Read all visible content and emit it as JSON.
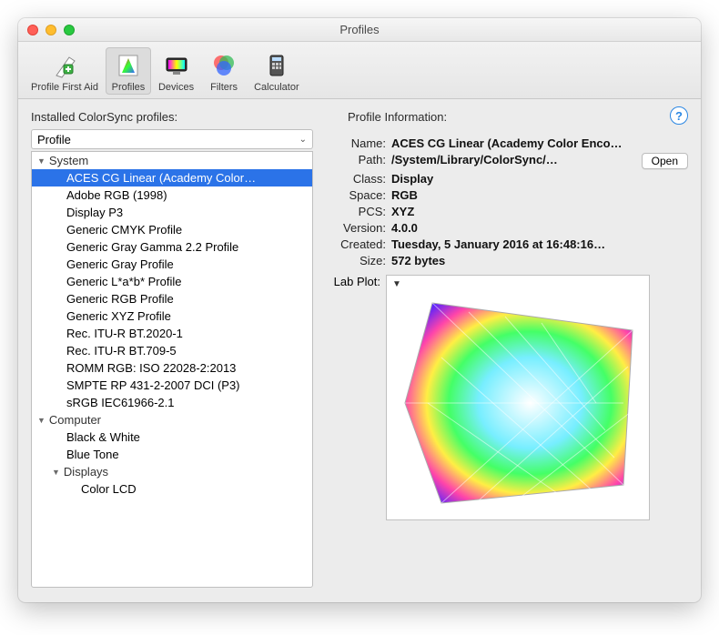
{
  "title": "Profiles",
  "toolbar": [
    {
      "label": "Profile First Aid",
      "name": "tb-profile-first-aid"
    },
    {
      "label": "Profiles",
      "name": "tb-profiles"
    },
    {
      "label": "Devices",
      "name": "tb-devices"
    },
    {
      "label": "Filters",
      "name": "tb-filters"
    },
    {
      "label": "Calculator",
      "name": "tb-calculator"
    }
  ],
  "left_heading": "Installed ColorSync profiles:",
  "dropdown_value": "Profile",
  "groups": {
    "system_label": "System",
    "computer_label": "Computer",
    "displays_label": "Displays"
  },
  "system_items": [
    "ACES CG Linear (Academy Color…",
    "Adobe RGB (1998)",
    "Display P3",
    "Generic CMYK Profile",
    "Generic Gray Gamma 2.2 Profile",
    "Generic Gray Profile",
    "Generic L*a*b* Profile",
    "Generic RGB Profile",
    "Generic XYZ Profile",
    "Rec. ITU-R BT.2020-1",
    "Rec. ITU-R BT.709-5",
    "ROMM RGB: ISO 22028-2:2013",
    "SMPTE RP 431-2-2007 DCI (P3)",
    "sRGB IEC61966-2.1"
  ],
  "computer_items": [
    "Black & White",
    "Blue Tone"
  ],
  "displays_items": [
    "Color LCD"
  ],
  "right_heading": "Profile Information:",
  "info_labels": {
    "name": "Name:",
    "path": "Path:",
    "class": "Class:",
    "space": "Space:",
    "pcs": "PCS:",
    "version": "Version:",
    "created": "Created:",
    "size": "Size:",
    "labplot": "Lab Plot:"
  },
  "info": {
    "name": "ACES CG Linear (Academy Color Enco…",
    "path": "/System/Library/ColorSync/…",
    "class": "Display",
    "space": "RGB",
    "pcs": "XYZ",
    "version": "4.0.0",
    "created": "Tuesday, 5 January 2016 at 16:48:16…",
    "size": "572 bytes"
  },
  "open_button": "Open"
}
